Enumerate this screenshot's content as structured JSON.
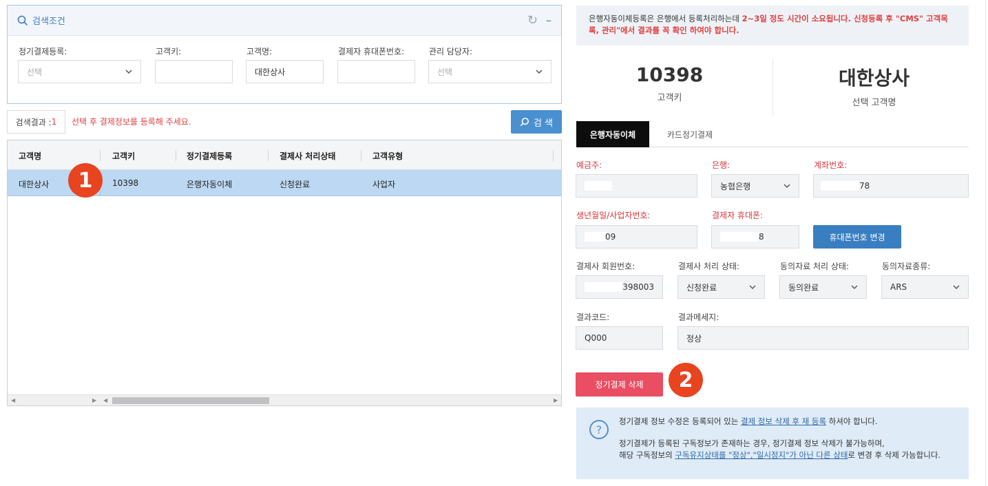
{
  "search": {
    "title": "검색조건",
    "fields": {
      "regular_payment_label": "정기결제등록:",
      "regular_payment_placeholder": "선택",
      "customer_key_label": "고객키:",
      "customer_key_value": "",
      "customer_name_label": "고객명:",
      "customer_name_value": "대한상사",
      "payer_phone_label": "결제자 휴대폰번호:",
      "payer_phone_value": "",
      "manager_label": "관리 담당자:",
      "manager_placeholder": "선택"
    },
    "result_label": "검색결과 : ",
    "result_count": "1",
    "hint": "선택 후 결제정보를 등록해 주세요.",
    "search_button": "검 색"
  },
  "grid": {
    "columns": [
      "고객명",
      "고객키",
      "정기결제등록",
      "결제사 처리상태",
      "고객유형"
    ],
    "rows": [
      [
        "대한상사",
        "10398",
        "은행자동이체",
        "신청완료",
        "사업자"
      ]
    ]
  },
  "badges": {
    "one": "1",
    "two": "2"
  },
  "notice": {
    "part1": "은행자동이체등록은 은행에서 등록처리하는데 ",
    "part2": "2~3일 정도 시간이 소요됩니다. 신청등록 후 \"CMS\" 고객목록, 관리\"에서 결과를 꼭 확인 하여야 합니다."
  },
  "summary": {
    "customer_key": "10398",
    "customer_key_label": "고객키",
    "customer_name": "대한상사",
    "customer_name_label": "선택 고객명"
  },
  "tabs": {
    "bank": "은행자동이체",
    "card": "카드정기결제"
  },
  "form": {
    "depositor_label": "예금주:",
    "bank_label": "은행:",
    "bank_value": "농협은행",
    "account_label": "계좌번호:",
    "account_tail": "78",
    "birth_label": "생년월일/사업자번호:",
    "birth_tail": "09",
    "payer_phone_label": "결제자 휴대폰:",
    "payer_phone_tail": "8",
    "change_phone_button": "휴대폰번호 변경",
    "member_no_label": "결제사 회원번호:",
    "member_no_tail": "398003",
    "process_status_label": "결제사 처리 상태:",
    "process_status_value": "신청완료",
    "consent_status_label": "동의자료 처리 상태:",
    "consent_status_value": "동의완료",
    "consent_type_label": "동의자료종류:",
    "consent_type_value": "ARS",
    "result_code_label": "결과코드:",
    "result_code_value": "Q000",
    "result_msg_label": "결과메세지:",
    "result_msg_value": "정상",
    "delete_button": "정기결제 삭제"
  },
  "info": {
    "line1_a": "정기결제 정보 수정은 등록되어 있는 ",
    "line1_link": "결제 정보 삭제 후 재 등록",
    "line1_b": " 하셔야 합니다.",
    "line2": "정기결제가 등록된 구독정보가 존재하는 경우, 정기결제 정보 삭제가 불가능하며,",
    "line3_a": "해당 구독정보의 ",
    "line3_link": "구독유지상태를 \"정상\",\"일시정지\"가 아닌 다른 상태",
    "line3_b": "로 변경 후 삭제 가능합니다."
  }
}
